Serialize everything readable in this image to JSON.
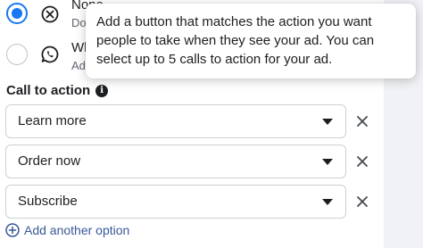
{
  "options": [
    {
      "title": "None",
      "subtitle": "Do",
      "selected": true,
      "icon": "x-circle-icon"
    },
    {
      "title": "Wh",
      "subtitle": "Ad",
      "selected": false,
      "icon": "whatsapp-icon"
    }
  ],
  "tooltip": {
    "text": "Add a button that matches the action you want people to take when they see your ad. You can select up to 5 calls to action for your ad."
  },
  "call_to_action": {
    "label": "Call to action",
    "selects": [
      {
        "value": "Learn more"
      },
      {
        "value": "Order now"
      },
      {
        "value": "Subscribe"
      }
    ],
    "add_label": "Add another option"
  },
  "colors": {
    "accent": "#1877f2",
    "link": "#385898",
    "border": "#ccd0d5"
  }
}
